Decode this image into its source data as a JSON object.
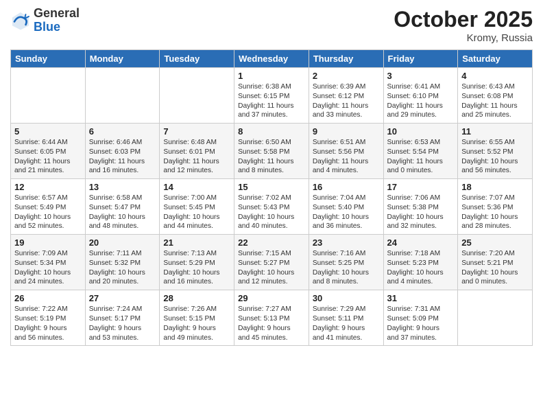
{
  "header": {
    "logo_general": "General",
    "logo_blue": "Blue",
    "month_year": "October 2025",
    "location": "Kromy, Russia"
  },
  "days_of_week": [
    "Sunday",
    "Monday",
    "Tuesday",
    "Wednesday",
    "Thursday",
    "Friday",
    "Saturday"
  ],
  "weeks": [
    [
      {
        "day": "",
        "info": ""
      },
      {
        "day": "",
        "info": ""
      },
      {
        "day": "",
        "info": ""
      },
      {
        "day": "1",
        "info": "Sunrise: 6:38 AM\nSunset: 6:15 PM\nDaylight: 11 hours\nand 37 minutes."
      },
      {
        "day": "2",
        "info": "Sunrise: 6:39 AM\nSunset: 6:12 PM\nDaylight: 11 hours\nand 33 minutes."
      },
      {
        "day": "3",
        "info": "Sunrise: 6:41 AM\nSunset: 6:10 PM\nDaylight: 11 hours\nand 29 minutes."
      },
      {
        "day": "4",
        "info": "Sunrise: 6:43 AM\nSunset: 6:08 PM\nDaylight: 11 hours\nand 25 minutes."
      }
    ],
    [
      {
        "day": "5",
        "info": "Sunrise: 6:44 AM\nSunset: 6:05 PM\nDaylight: 11 hours\nand 21 minutes."
      },
      {
        "day": "6",
        "info": "Sunrise: 6:46 AM\nSunset: 6:03 PM\nDaylight: 11 hours\nand 16 minutes."
      },
      {
        "day": "7",
        "info": "Sunrise: 6:48 AM\nSunset: 6:01 PM\nDaylight: 11 hours\nand 12 minutes."
      },
      {
        "day": "8",
        "info": "Sunrise: 6:50 AM\nSunset: 5:58 PM\nDaylight: 11 hours\nand 8 minutes."
      },
      {
        "day": "9",
        "info": "Sunrise: 6:51 AM\nSunset: 5:56 PM\nDaylight: 11 hours\nand 4 minutes."
      },
      {
        "day": "10",
        "info": "Sunrise: 6:53 AM\nSunset: 5:54 PM\nDaylight: 11 hours\nand 0 minutes."
      },
      {
        "day": "11",
        "info": "Sunrise: 6:55 AM\nSunset: 5:52 PM\nDaylight: 10 hours\nand 56 minutes."
      }
    ],
    [
      {
        "day": "12",
        "info": "Sunrise: 6:57 AM\nSunset: 5:49 PM\nDaylight: 10 hours\nand 52 minutes."
      },
      {
        "day": "13",
        "info": "Sunrise: 6:58 AM\nSunset: 5:47 PM\nDaylight: 10 hours\nand 48 minutes."
      },
      {
        "day": "14",
        "info": "Sunrise: 7:00 AM\nSunset: 5:45 PM\nDaylight: 10 hours\nand 44 minutes."
      },
      {
        "day": "15",
        "info": "Sunrise: 7:02 AM\nSunset: 5:43 PM\nDaylight: 10 hours\nand 40 minutes."
      },
      {
        "day": "16",
        "info": "Sunrise: 7:04 AM\nSunset: 5:40 PM\nDaylight: 10 hours\nand 36 minutes."
      },
      {
        "day": "17",
        "info": "Sunrise: 7:06 AM\nSunset: 5:38 PM\nDaylight: 10 hours\nand 32 minutes."
      },
      {
        "day": "18",
        "info": "Sunrise: 7:07 AM\nSunset: 5:36 PM\nDaylight: 10 hours\nand 28 minutes."
      }
    ],
    [
      {
        "day": "19",
        "info": "Sunrise: 7:09 AM\nSunset: 5:34 PM\nDaylight: 10 hours\nand 24 minutes."
      },
      {
        "day": "20",
        "info": "Sunrise: 7:11 AM\nSunset: 5:32 PM\nDaylight: 10 hours\nand 20 minutes."
      },
      {
        "day": "21",
        "info": "Sunrise: 7:13 AM\nSunset: 5:29 PM\nDaylight: 10 hours\nand 16 minutes."
      },
      {
        "day": "22",
        "info": "Sunrise: 7:15 AM\nSunset: 5:27 PM\nDaylight: 10 hours\nand 12 minutes."
      },
      {
        "day": "23",
        "info": "Sunrise: 7:16 AM\nSunset: 5:25 PM\nDaylight: 10 hours\nand 8 minutes."
      },
      {
        "day": "24",
        "info": "Sunrise: 7:18 AM\nSunset: 5:23 PM\nDaylight: 10 hours\nand 4 minutes."
      },
      {
        "day": "25",
        "info": "Sunrise: 7:20 AM\nSunset: 5:21 PM\nDaylight: 10 hours\nand 0 minutes."
      }
    ],
    [
      {
        "day": "26",
        "info": "Sunrise: 7:22 AM\nSunset: 5:19 PM\nDaylight: 9 hours\nand 56 minutes."
      },
      {
        "day": "27",
        "info": "Sunrise: 7:24 AM\nSunset: 5:17 PM\nDaylight: 9 hours\nand 53 minutes."
      },
      {
        "day": "28",
        "info": "Sunrise: 7:26 AM\nSunset: 5:15 PM\nDaylight: 9 hours\nand 49 minutes."
      },
      {
        "day": "29",
        "info": "Sunrise: 7:27 AM\nSunset: 5:13 PM\nDaylight: 9 hours\nand 45 minutes."
      },
      {
        "day": "30",
        "info": "Sunrise: 7:29 AM\nSunset: 5:11 PM\nDaylight: 9 hours\nand 41 minutes."
      },
      {
        "day": "31",
        "info": "Sunrise: 7:31 AM\nSunset: 5:09 PM\nDaylight: 9 hours\nand 37 minutes."
      },
      {
        "day": "",
        "info": ""
      }
    ]
  ]
}
